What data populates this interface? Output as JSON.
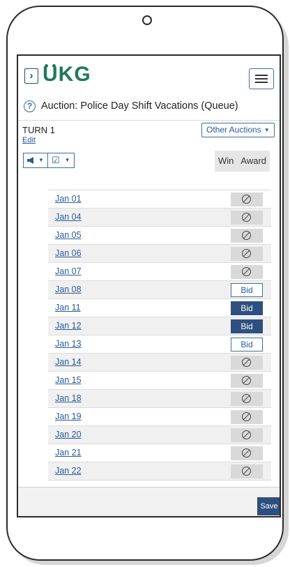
{
  "header": {
    "logo_text": "UKG",
    "brand_color": "#1e7a5a",
    "expand_icon": "chevron-right-icon",
    "menu_icon": "hamburger-icon"
  },
  "page": {
    "title": "Auction: Police Day Shift Vacations (Queue)",
    "help_icon": "question-icon"
  },
  "turn": {
    "label": "TURN 1",
    "edit_link": "Edit"
  },
  "controls": {
    "other_auctions_label": "Other Auctions",
    "announce_icon": "megaphone-icon",
    "edit_check_icon": "edit-check-icon",
    "win_label": "Win",
    "award_label": "Award"
  },
  "dates": [
    {
      "label": "Jan 01",
      "status": "blocked",
      "bid_label": ""
    },
    {
      "label": "Jan 04",
      "status": "blocked",
      "bid_label": ""
    },
    {
      "label": "Jan 05",
      "status": "blocked",
      "bid_label": ""
    },
    {
      "label": "Jan 06",
      "status": "blocked",
      "bid_label": ""
    },
    {
      "label": "Jan 07",
      "status": "blocked",
      "bid_label": ""
    },
    {
      "label": "Jan 08",
      "status": "bid",
      "bid_label": "Bid"
    },
    {
      "label": "Jan 11",
      "status": "selected",
      "bid_label": "Bid"
    },
    {
      "label": "Jan 12",
      "status": "selected",
      "bid_label": "Bid"
    },
    {
      "label": "Jan 13",
      "status": "bid",
      "bid_label": "Bid"
    },
    {
      "label": "Jan 14",
      "status": "blocked",
      "bid_label": ""
    },
    {
      "label": "Jan 15",
      "status": "blocked",
      "bid_label": ""
    },
    {
      "label": "Jan 18",
      "status": "blocked",
      "bid_label": ""
    },
    {
      "label": "Jan 19",
      "status": "blocked",
      "bid_label": ""
    },
    {
      "label": "Jan 20",
      "status": "blocked",
      "bid_label": ""
    },
    {
      "label": "Jan 21",
      "status": "blocked",
      "bid_label": ""
    },
    {
      "label": "Jan 22",
      "status": "blocked",
      "bid_label": ""
    }
  ],
  "footer": {
    "save_label": "Save"
  },
  "colors": {
    "accent": "#2e4f7f",
    "link": "#2a5a9a",
    "blocked_cell": "#d9d9d9"
  }
}
